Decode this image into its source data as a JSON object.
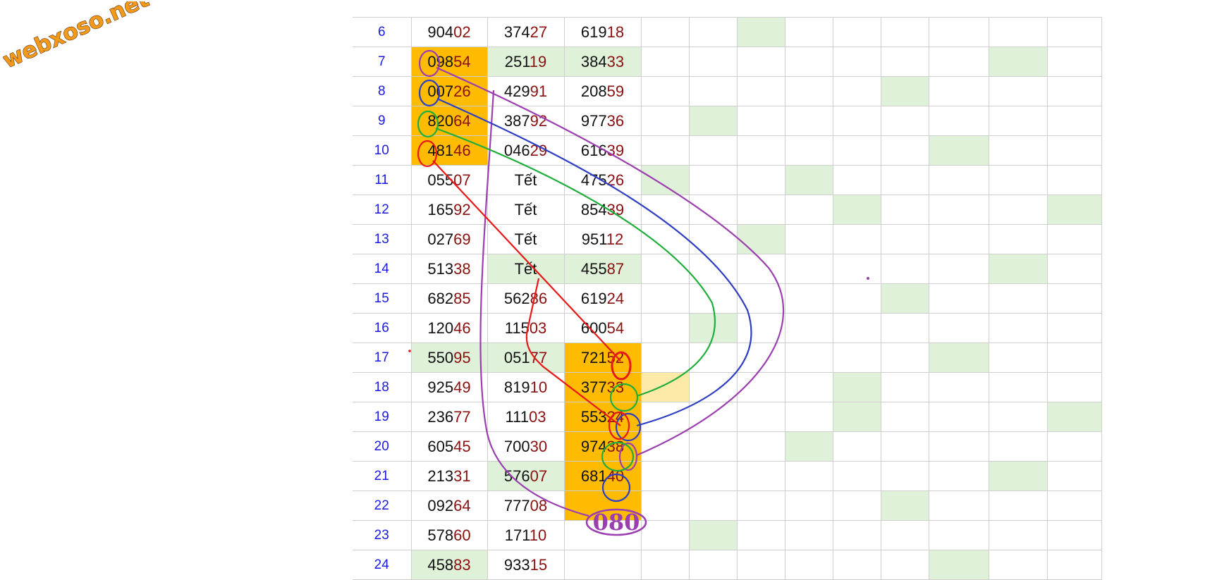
{
  "logo": {
    "text": "webxoso.net"
  },
  "colors": {
    "index": "#1a1ae6",
    "tail_digits": "#8b1010",
    "green_cell": "#e0f1da",
    "highlight_cell": "#ffbb00",
    "light_highlight": "#fde9a8",
    "red_line": "#e81818",
    "blue_line": "#2d3ec4",
    "green_line": "#1fae3c",
    "purple_line": "#9b3fb0"
  },
  "table": {
    "rows": [
      {
        "idx": "6",
        "c1": "90402",
        "c2": "37427",
        "c3": "61918"
      },
      {
        "idx": "7",
        "c1": "09854",
        "c2": "25119",
        "c3": "38433"
      },
      {
        "idx": "8",
        "c1": "00726",
        "c2": "42991",
        "c3": "20859"
      },
      {
        "idx": "9",
        "c1": "82064",
        "c2": "38792",
        "c3": "97736"
      },
      {
        "idx": "10",
        "c1": "48146",
        "c2": "04629",
        "c3": "61639"
      },
      {
        "idx": "11",
        "c1": "05507",
        "c2": "Tết",
        "c3": "47526"
      },
      {
        "idx": "12",
        "c1": "16592",
        "c2": "Tết",
        "c3": "85439"
      },
      {
        "idx": "13",
        "c1": "02769",
        "c2": "Tết",
        "c3": "95112"
      },
      {
        "idx": "14",
        "c1": "51338",
        "c2": "Tết",
        "c3": "45587"
      },
      {
        "idx": "15",
        "c1": "68285",
        "c2": "56286",
        "c3": "61924"
      },
      {
        "idx": "16",
        "c1": "12046",
        "c2": "11503",
        "c3": "60054"
      },
      {
        "idx": "17",
        "c1": "55095",
        "c2": "05177",
        "c3": "72152"
      },
      {
        "idx": "18",
        "c1": "92549",
        "c2": "81910",
        "c3": "37733"
      },
      {
        "idx": "19",
        "c1": "23677",
        "c2": "11103",
        "c3": "55324"
      },
      {
        "idx": "20",
        "c1": "60545",
        "c2": "70030",
        "c3": "97438"
      },
      {
        "idx": "21",
        "c1": "21331",
        "c2": "57607",
        "c3": "68140"
      },
      {
        "idx": "22",
        "c1": "09264",
        "c2": "77708",
        "c3": ""
      },
      {
        "idx": "23",
        "c1": "57860",
        "c2": "17110",
        "c3": ""
      },
      {
        "idx": "24",
        "c1": "45883",
        "c2": "93315",
        "c3": ""
      }
    ]
  },
  "annotation": {
    "text": "080"
  }
}
